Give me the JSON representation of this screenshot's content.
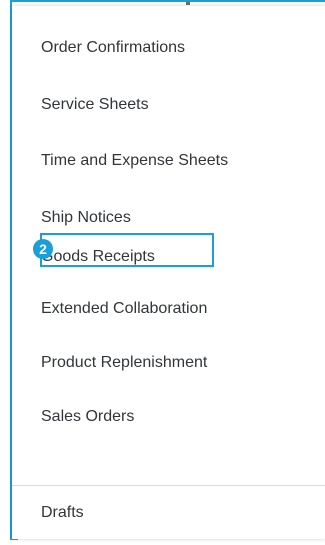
{
  "menu": {
    "items": [
      {
        "label": "Order Confirmations"
      },
      {
        "label": "Service Sheets"
      },
      {
        "label": "Time and Expense Sheets"
      },
      {
        "label": "Ship Notices"
      },
      {
        "label": "Goods Receipts"
      },
      {
        "label": "Extended Collaboration"
      },
      {
        "label": "Product Replenishment"
      },
      {
        "label": "Sales Orders"
      },
      {
        "label": "Drafts"
      }
    ]
  },
  "annotation": {
    "step_number": "2",
    "highlighted_item": "Goods Receipts"
  },
  "colors": {
    "accent": "#1a9fd6",
    "text": "#32363a",
    "divider": "#d9d9d9",
    "background": "#ffffff"
  }
}
